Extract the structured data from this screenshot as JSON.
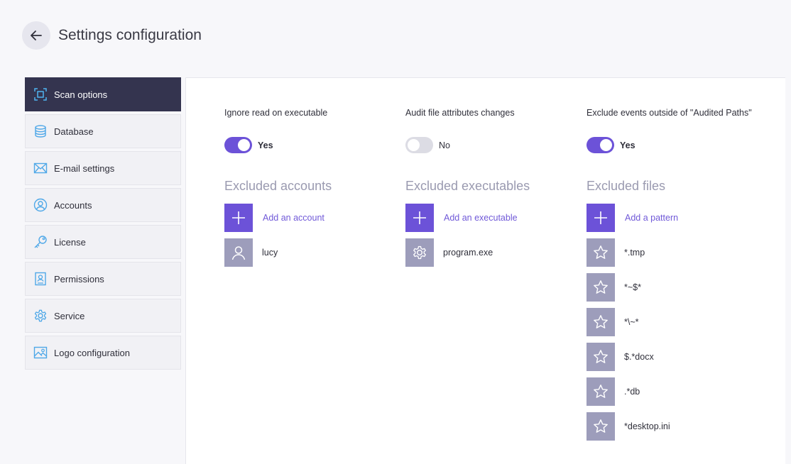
{
  "header": {
    "title": "Settings configuration"
  },
  "sidebar": {
    "items": [
      {
        "label": "Scan options",
        "icon": "scan-icon",
        "active": true
      },
      {
        "label": "Database",
        "icon": "database-icon"
      },
      {
        "label": "E-mail settings",
        "icon": "mail-icon"
      },
      {
        "label": "Accounts",
        "icon": "user-circle-icon"
      },
      {
        "label": "License",
        "icon": "key-icon"
      },
      {
        "label": "Permissions",
        "icon": "badge-icon"
      },
      {
        "label": "Service",
        "icon": "gear-icon"
      },
      {
        "label": "Logo configuration",
        "icon": "image-icon"
      }
    ]
  },
  "options": [
    {
      "label": "Ignore read on executable",
      "value": "Yes",
      "enabled": true
    },
    {
      "label": "Audit file attributes changes",
      "value": "No",
      "enabled": false
    },
    {
      "label": "Exclude events outside of \"Audited Paths\"",
      "value": "Yes",
      "enabled": true
    }
  ],
  "excluded_accounts": {
    "title": "Excluded accounts",
    "add_label": "Add an account",
    "items": [
      "lucy"
    ]
  },
  "excluded_executables": {
    "title": "Excluded executables",
    "add_label": "Add an executable",
    "items": [
      "program.exe"
    ]
  },
  "excluded_files": {
    "title": "Excluded files",
    "add_label": "Add a pattern",
    "items": [
      "*.tmp",
      "*~$*",
      "*\\~*",
      "$.*docx",
      ".*db",
      "*desktop.ini"
    ]
  },
  "colors": {
    "accent": "#6c52d8",
    "sidebar_active": "#34344f",
    "tile_gray": "#9d9dbb"
  }
}
